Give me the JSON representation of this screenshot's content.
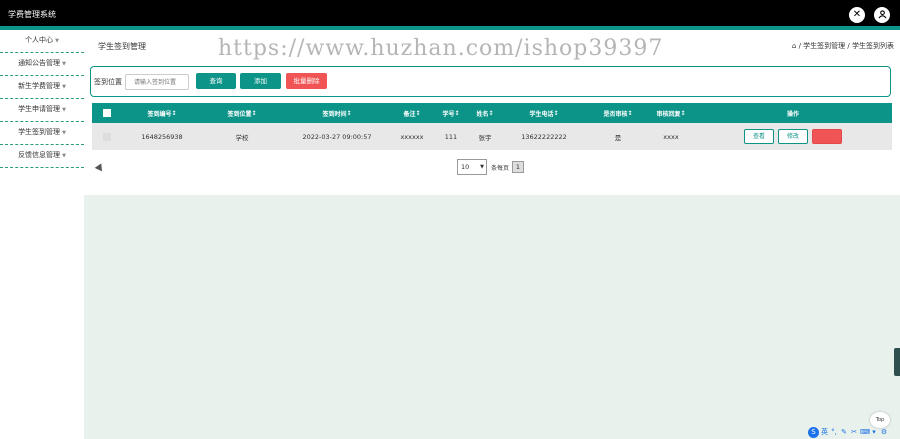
{
  "app": {
    "title": "学费管理系统"
  },
  "header_icons": [
    "close-icon",
    "user-icon"
  ],
  "sidebar": {
    "items": [
      {
        "label": "个人中心"
      },
      {
        "label": "通知公告管理"
      },
      {
        "label": "新生学费管理"
      },
      {
        "label": "学生申请管理"
      },
      {
        "label": "学生签到管理"
      },
      {
        "label": "反馈信息管理"
      }
    ]
  },
  "page": {
    "title": "学生签到管理",
    "breadcrumb": "/ 学生签到管理 / 学生签到列表"
  },
  "watermark": "https://www.huzhan.com/ishop39397",
  "search": {
    "label": "签到位置",
    "placeholder": "请输入签到位置",
    "query_button": "查询",
    "add_button": "添加",
    "batch_delete_button": "批量删除"
  },
  "table": {
    "headers": [
      "签到编号",
      "签到位置",
      "签到时间",
      "备注",
      "学号",
      "姓名",
      "学生电话",
      "是否审核",
      "审核回复",
      "操作"
    ],
    "rows": [
      {
        "cells": [
          "1648256938",
          "学校",
          "2022-03-27 09:00:57",
          "xxxxxx",
          "111",
          "张宇",
          "13622222222",
          "是",
          "xxxx"
        ],
        "actions": {
          "view": "查看",
          "edit": "修改",
          "delete": "删除"
        }
      }
    ]
  },
  "pagination": {
    "page_size": "10",
    "per_page_label": "条每页",
    "current_page": "1"
  },
  "floating": {
    "top_button": "Top",
    "ime_label": "英"
  },
  "colors": {
    "accent": "#0d9488",
    "danger": "#f05454",
    "topbar": "#000000"
  }
}
